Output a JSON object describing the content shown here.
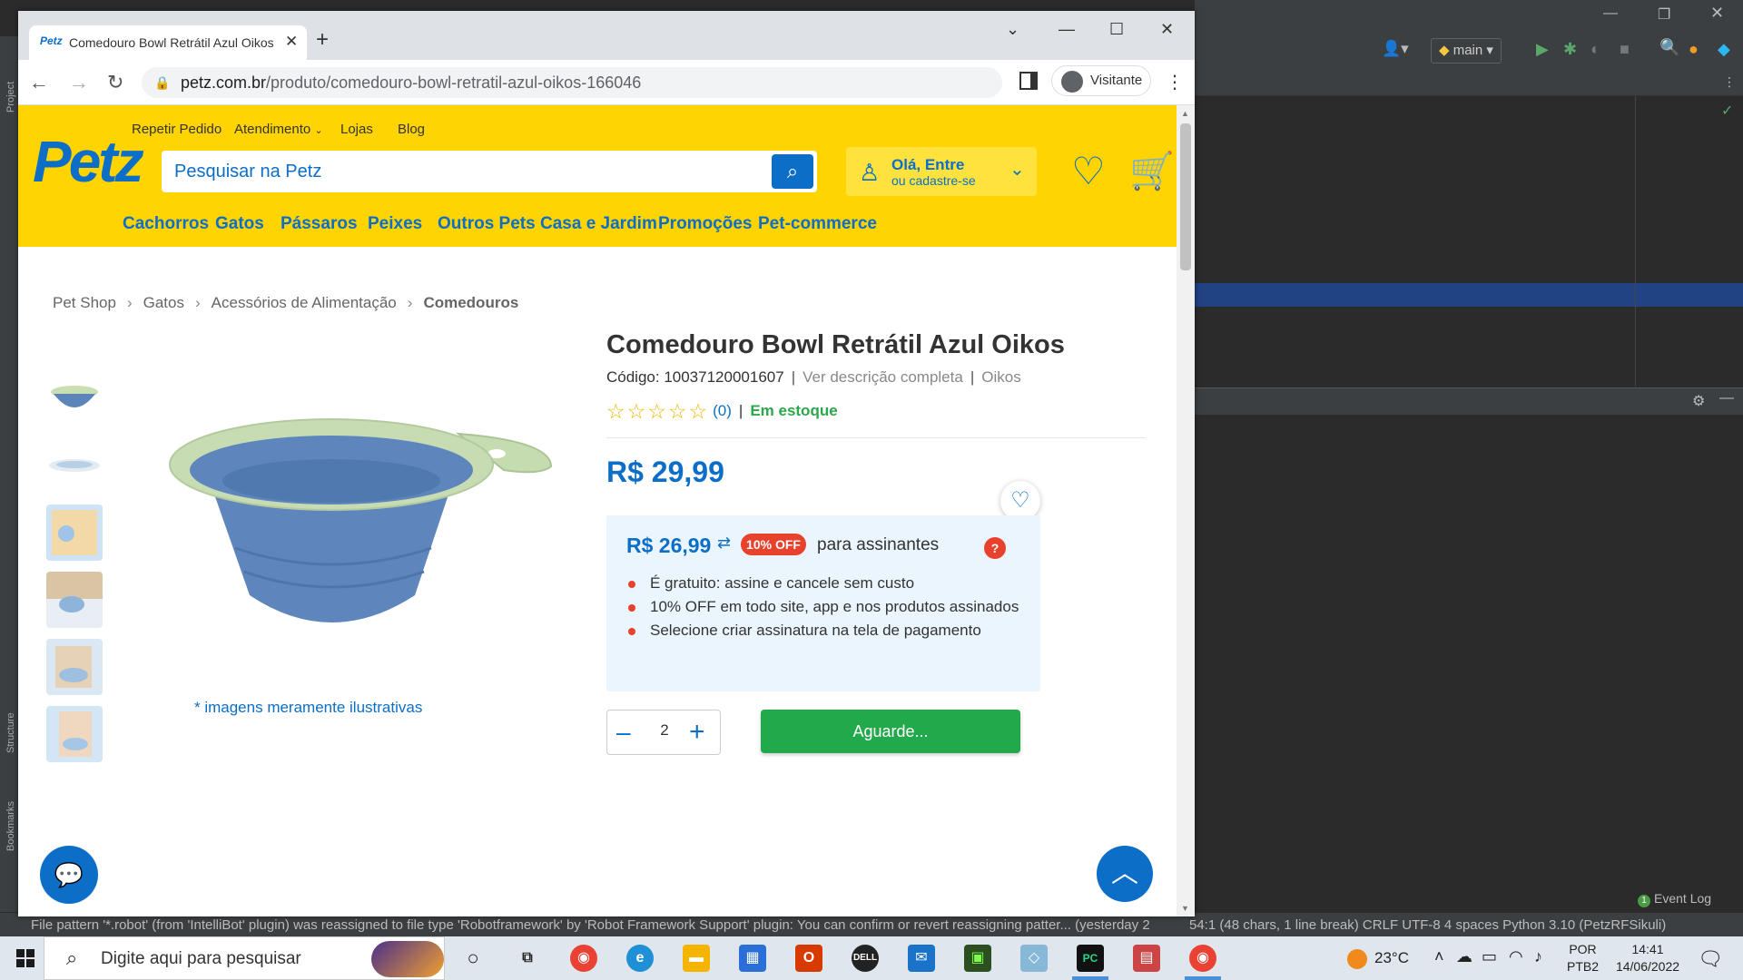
{
  "ide": {
    "branch": "main",
    "status_message": "File pattern '*.robot' (from 'IntelliBot' plugin) was reassigned to file type 'Robotframework' by 'Robot Framework Support' plugin: You can confirm or revert reassigning patter... (yesterday 2",
    "status_right": "54:1 (48 chars, 1 line break)   CRLF   UTF-8   4 spaces   Python 3.10 (PetzRFSikuli)",
    "event_log_count": "1",
    "event_log_label": "Event Log",
    "side_labels": [
      "Project",
      "Structure",
      "Bookmarks"
    ]
  },
  "browser": {
    "tab_title": "Comedouro Bowl Retrátil Azul Oikos",
    "tab_favicon": "Petz",
    "url_domain": "petz.com.br",
    "url_path": "/produto/comedouro-bowl-retratil-azul-oikos-166046",
    "profile_label": "Visitante"
  },
  "header": {
    "logo": "Petz",
    "top_links": [
      "Repetir Pedido",
      "Atendimento",
      "Lojas",
      "Blog"
    ],
    "search_placeholder": "Pesquisar na Petz",
    "login_line1": "Olá, Entre",
    "login_line2": "ou cadastre-se",
    "categories": [
      "Cachorros",
      "Gatos",
      "Pássaros",
      "Peixes",
      "Outros Pets",
      "Casa e Jardim",
      "Promoções",
      "Pet-commerce"
    ]
  },
  "breadcrumb": [
    "Pet Shop",
    "Gatos",
    "Acessórios de Alimentação",
    "Comedouros"
  ],
  "product": {
    "title": "Comedouro Bowl Retrátil Azul Oikos",
    "code_label": "Código: 10037120001607",
    "see_description": "Ver descrição completa",
    "brand": "Oikos",
    "stars": "☆☆☆☆☆",
    "rating_count": "(0)",
    "stock": "Em estoque",
    "price": "R$ 29,99",
    "subscriber_price": "R$ 26,99",
    "discount_badge": "10% OFF",
    "subscriber_label": "para assinantes",
    "benefits": [
      "É gratuito: assine e cancele sem custo",
      "10% OFF em todo site, app e nos produtos assinados",
      "Selecione criar assinatura na tela de pagamento"
    ],
    "quantity": "2",
    "add_button": "Aguarde...",
    "image_note": "* imagens meramente ilustrativas"
  },
  "taskbar": {
    "search_placeholder": "Digite aqui para pesquisar",
    "temperature": "23°C",
    "lang_line1": "POR",
    "lang_line2": "PTB2",
    "time": "14:41",
    "date": "14/06/2022"
  },
  "colors": {
    "brand_yellow": "#ffd400",
    "brand_blue": "#0c6ec7",
    "success_green": "#22a94b",
    "discount_red": "#e8412c"
  }
}
